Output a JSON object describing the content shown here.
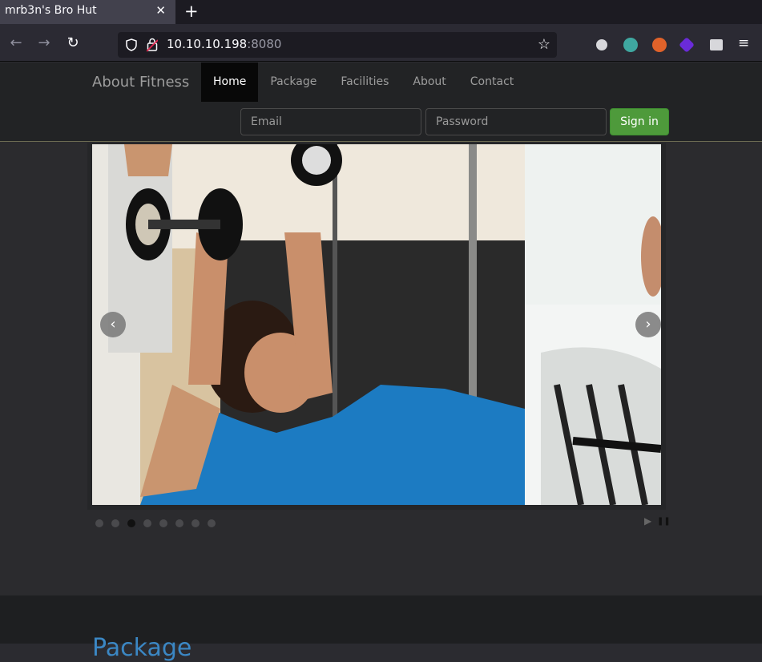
{
  "browser": {
    "tab_title": "mrb3n's Bro Hut",
    "tab_close": "✕",
    "new_tab": "+",
    "back": "←",
    "forward": "→",
    "reload": "↻",
    "url_host": "10.10.10.198",
    "url_port": ":8080",
    "bookmark": "☆",
    "menu": "≡"
  },
  "site": {
    "brand": "About Fitness",
    "menu": [
      "Home",
      "Package",
      "Facilities",
      "About",
      "Contact"
    ],
    "email_placeholder": "Email",
    "password_placeholder": "Password",
    "signin": "Sign in"
  },
  "slider": {
    "prev": "‹",
    "next": "›",
    "dot_count": 8,
    "active_dot": 3,
    "play": "▶",
    "pause": "❚❚"
  },
  "section": {
    "heading": "Package"
  }
}
